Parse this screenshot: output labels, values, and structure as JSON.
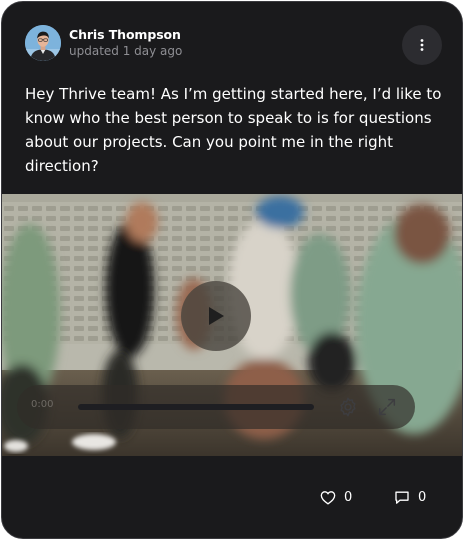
{
  "post": {
    "author": {
      "name": "Chris Thompson",
      "updated": "updated 1 day ago",
      "avatar_icon": "user-avatar"
    },
    "menu_icon": "more-vertical-icon",
    "text": "Hey Thrive team! As I’m getting started here, I’d like to know who the best person to speak to is for questions about our projects. Can you point me in the right direction?",
    "video": {
      "current_time": "0:00",
      "progress": 0,
      "play_icon": "play-icon",
      "settings_icon": "gear-icon",
      "fullscreen_icon": "fullscreen-icon"
    },
    "reactions": {
      "likes": "0",
      "comments": "0",
      "like_icon": "heart-icon",
      "comment_icon": "comment-icon"
    }
  },
  "colors": {
    "card_bg": "#1a1a1c",
    "text": "#ffffff",
    "muted": "#8e8e93",
    "menu_bg": "#2c2c30"
  }
}
